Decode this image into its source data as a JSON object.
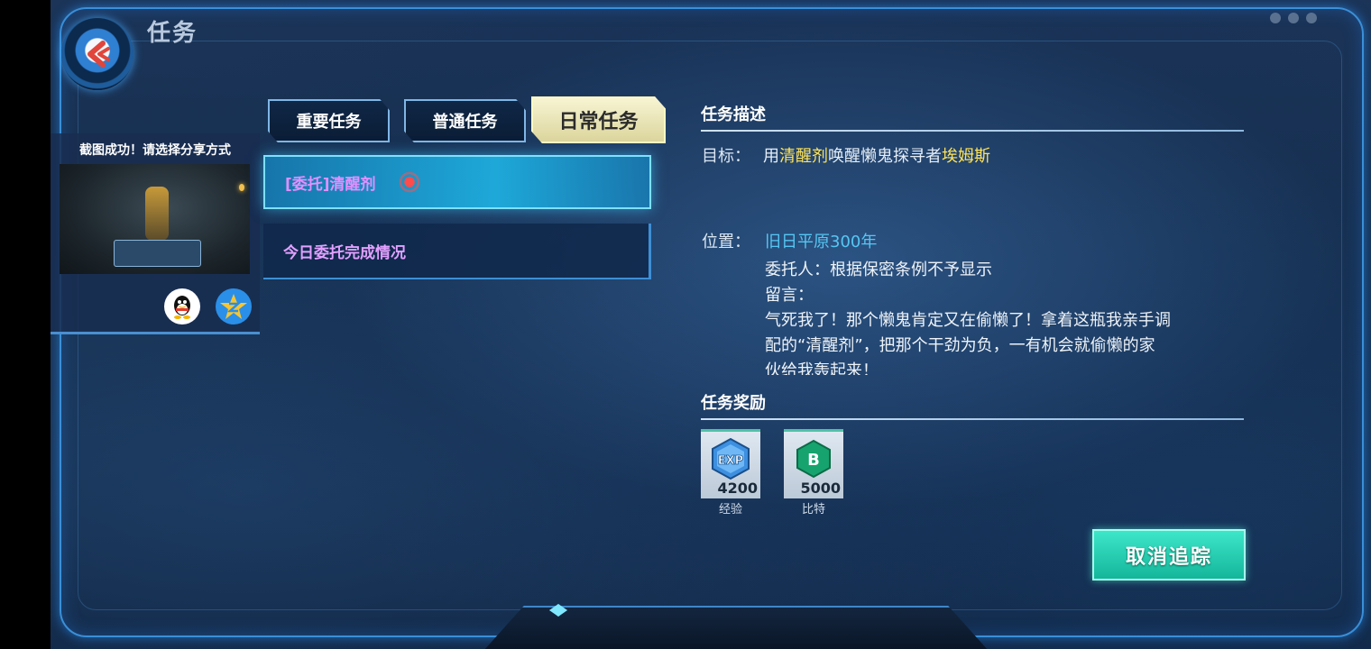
{
  "header": {
    "title": "任务"
  },
  "share": {
    "title": "截图成功！请选择分享方式",
    "options": [
      "qq-icon",
      "qzone-icon"
    ]
  },
  "tabs": [
    {
      "label": "重要任务",
      "active": false
    },
    {
      "label": "普通任务",
      "active": false
    },
    {
      "label": "日常任务",
      "active": true
    }
  ],
  "quests": [
    {
      "label": "[委托]清醒剂",
      "active": true
    },
    {
      "label": "今日委托完成情况",
      "active": false
    }
  ],
  "detail": {
    "section_title": "任务描述",
    "goal_label": "目标：",
    "goal_parts": [
      "用",
      "清醒剂",
      "唤醒懒鬼探寻者",
      "埃姆斯"
    ],
    "location_label": "位置：",
    "location_value": "旧日平原300年",
    "desc_lines": [
      "委托人：根据保密条例不予显示",
      "留言：",
      "气死我了！那个懒鬼肯定又在偷懒了！拿着这瓶我亲手调",
      "配的“清醒剂”，把那个干劲为负，一有机会就偷懒的家",
      "伙给我轰起来！"
    ]
  },
  "rewards": {
    "section_title": "任务奖励",
    "items": [
      {
        "icon": "exp-icon",
        "amount": "4200",
        "label": "经验"
      },
      {
        "icon": "bit-icon",
        "amount": "5000",
        "label": "比特"
      }
    ]
  },
  "actions": {
    "cancel_tracking": "取消追踪"
  },
  "colors": {
    "accent_cyan": "#56c6f2",
    "highlight_yellow": "#ffe45a",
    "button_teal": "#14b69a",
    "tab_active": "#f7f4d2"
  }
}
